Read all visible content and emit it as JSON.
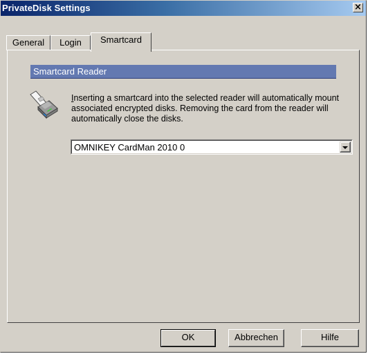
{
  "window": {
    "title": "PrivateDisk Settings",
    "close_glyph": "×"
  },
  "tabs": [
    {
      "label": "General",
      "active": false
    },
    {
      "label": "Login",
      "active": false
    },
    {
      "label": "Smartcard",
      "active": true
    }
  ],
  "smartcard": {
    "section_title": "Smartcard Reader",
    "icon": "smartcard-reader-icon",
    "description_first_letter": "I",
    "description_rest": "nserting a smartcard into the selected reader will automatically mount associated encrypted disks. Removing the card from the reader will automatically close the disks.",
    "reader_selected": "OMNIKEY CardMan  2010 0"
  },
  "buttons": {
    "ok": "OK",
    "cancel": "Abbrechen",
    "help": "Hilfe"
  },
  "colors": {
    "title_gradient_start": "#0a246a",
    "title_gradient_end": "#a6caf0",
    "section_header": "#6379b1",
    "dialog_face": "#d4d0c8"
  }
}
